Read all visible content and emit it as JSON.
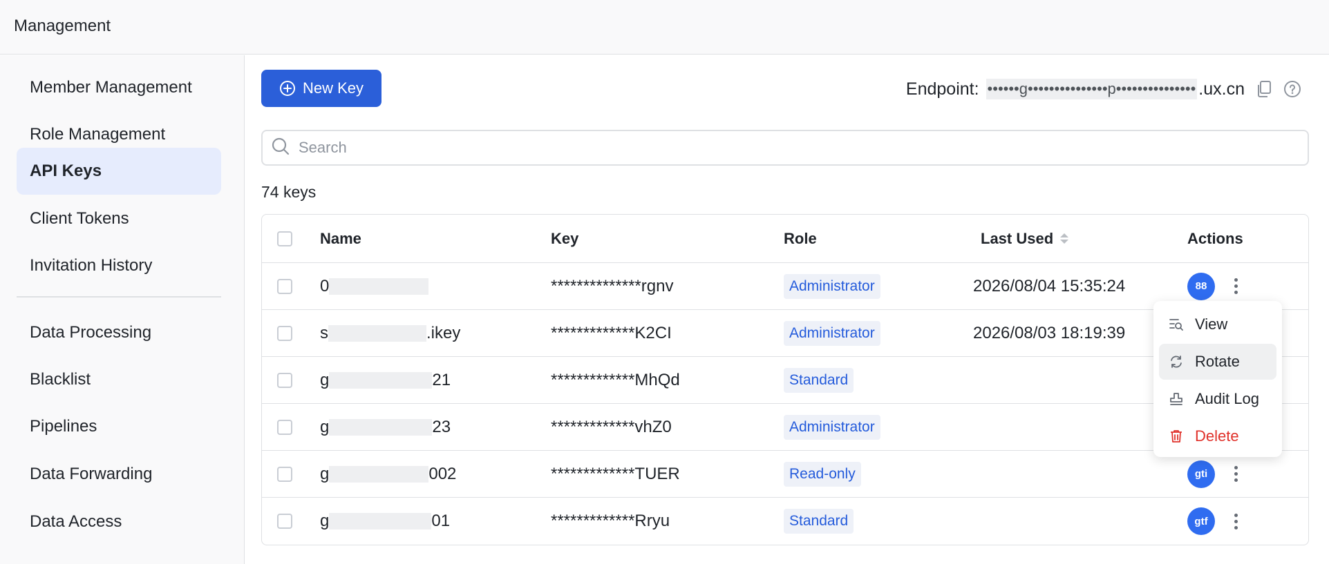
{
  "header": {
    "title": "Management"
  },
  "sidebar": {
    "items": [
      {
        "label": "Member Management",
        "active": false
      },
      {
        "label": "Role Management",
        "active": false
      },
      {
        "label": "API Keys",
        "active": true
      },
      {
        "label": "Client Tokens",
        "active": false
      },
      {
        "label": "Invitation History",
        "active": false
      },
      {
        "label": "Data Processing",
        "active": false
      },
      {
        "label": "Blacklist",
        "active": false
      },
      {
        "label": "Pipelines",
        "active": false
      },
      {
        "label": "Data Forwarding",
        "active": false
      },
      {
        "label": "Data Access",
        "active": false
      }
    ]
  },
  "toolbar": {
    "new_key_label": "New Key",
    "endpoint_label": "Endpoint:",
    "endpoint_masked": "••••••g•••••••••••••••p•••••••••••••••",
    "endpoint_suffix": ".ux.cn",
    "copy_icon": "copy-icon",
    "help_icon": "help-icon"
  },
  "search": {
    "placeholder": "Search"
  },
  "count_text": "74 keys",
  "table": {
    "columns": [
      "Name",
      "Key",
      "Role",
      "Last Used",
      "Actions"
    ],
    "rows": [
      {
        "name_prefix": "0",
        "name_suffix": "",
        "key": "**************rgnv",
        "role": "Administrator",
        "last_used": "2026/08/04 15:35:24",
        "avatar": "88"
      },
      {
        "name_prefix": "s",
        "name_suffix": ".ikey",
        "key": "*************K2CI",
        "role": "Administrator",
        "last_used": "2026/08/03 18:19:39",
        "avatar": ""
      },
      {
        "name_prefix": "g",
        "name_suffix": "21",
        "key": "*************MhQd",
        "role": "Standard",
        "last_used": "",
        "avatar": ""
      },
      {
        "name_prefix": "g",
        "name_suffix": "23",
        "key": "*************vhZ0",
        "role": "Administrator",
        "last_used": "",
        "avatar": ""
      },
      {
        "name_prefix": "g",
        "name_suffix": "002",
        "key": "*************TUER",
        "role": "Read-only",
        "last_used": "",
        "avatar": "gti"
      },
      {
        "name_prefix": "g",
        "name_suffix": "01",
        "key": "*************Rryu",
        "role": "Standard",
        "last_used": "",
        "avatar": "gtf"
      }
    ]
  },
  "action_menu": {
    "items": [
      {
        "label": "View",
        "icon": "view-icon"
      },
      {
        "label": "Rotate",
        "icon": "rotate-icon"
      },
      {
        "label": "Audit Log",
        "icon": "stamp-icon"
      },
      {
        "label": "Delete",
        "icon": "trash-icon"
      }
    ]
  },
  "colors": {
    "primary": "#2b5fd9",
    "active_nav_bg": "#e6ecfd",
    "danger": "#e0312a",
    "tag_text": "#245bdb"
  }
}
